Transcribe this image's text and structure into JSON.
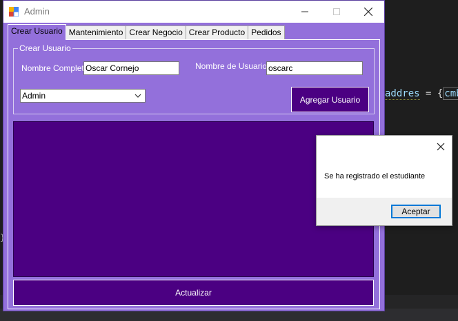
{
  "window": {
    "title": "Admin"
  },
  "tabs": [
    {
      "label": "Crear Usuario",
      "active": true
    },
    {
      "label": "Mantenimiento",
      "active": false
    },
    {
      "label": "Crear Negocio",
      "active": false
    },
    {
      "label": "Crear Producto",
      "active": false
    },
    {
      "label": "Pedidos",
      "active": false
    }
  ],
  "form": {
    "group_title": "Crear Usuario",
    "full_name_label": "Nombre Completo:",
    "full_name_value": "Oscar Cornejo",
    "username_label": "Nombre de Usuario:",
    "username_value": "oscarc",
    "role_selected": "Admin",
    "add_button": "Agregar Usuario"
  },
  "update_button": "Actualizar",
  "message_box": {
    "text": "Se ha registrado el estudiante",
    "ok_button": "Aceptar"
  },
  "background_code": {
    "identifier": "addres",
    "operator": " = {",
    "variable": "cmbD"
  },
  "colors": {
    "form_background": "#9370db",
    "panel_dark": "#4b0082",
    "ok_focus": "#0078d7"
  },
  "icons": [
    "app-icon",
    "minimize-icon",
    "maximize-icon",
    "close-icon",
    "chevron-down-icon"
  ]
}
